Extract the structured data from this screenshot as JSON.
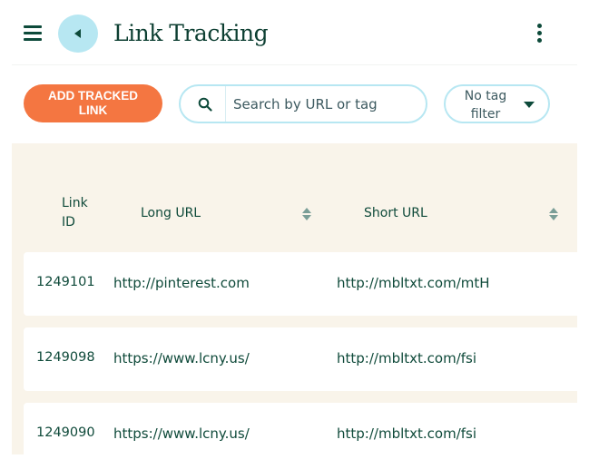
{
  "header": {
    "title": "Link Tracking",
    "menu_icon": "hamburger-menu-icon",
    "back_icon": "back-arrow-icon",
    "more_icon": "more-vertical-icon"
  },
  "toolbar": {
    "add_button_label": "ADD TRACKED LINK",
    "search_placeholder": "Search by URL or tag",
    "search_value": "",
    "tag_filter_label": "No tag filter"
  },
  "table": {
    "columns": [
      {
        "key": "id",
        "label": "Link ID",
        "sortable": false
      },
      {
        "key": "long_url",
        "label": "Long URL",
        "sortable": true
      },
      {
        "key": "short_url",
        "label": "Short URL",
        "sortable": true
      }
    ],
    "rows": [
      {
        "id": "1249101",
        "long_url": "http://pinterest.com",
        "short_url": "http://mbltxt.com/mtH"
      },
      {
        "id": "1249098",
        "long_url": "https://www.lcny.us/",
        "short_url": "http://mbltxt.com/fsi"
      },
      {
        "id": "1249090",
        "long_url": "https://www.lcny.us/",
        "short_url": "http://mbltxt.com/fsi"
      }
    ]
  },
  "colors": {
    "accent_orange": "#f47641",
    "accent_blue": "#b7e7f2",
    "text_dark_green": "#0f4a3a",
    "panel_cream": "#f9f4ea"
  }
}
